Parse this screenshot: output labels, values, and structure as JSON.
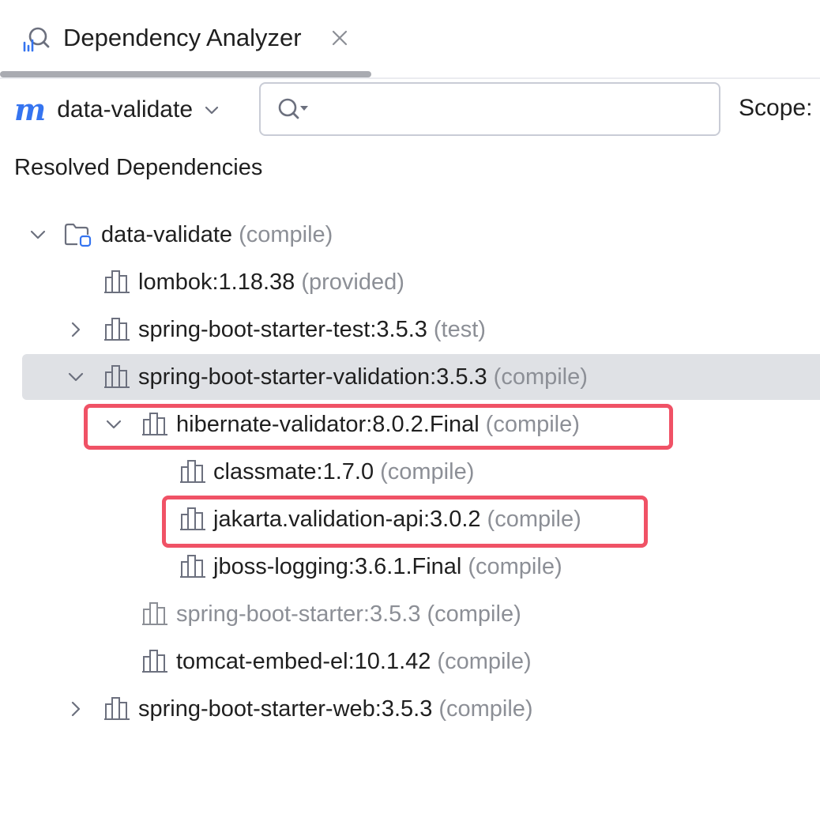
{
  "tab": {
    "title": "Dependency Analyzer"
  },
  "toolbar": {
    "module": "data-validate",
    "search_value": "",
    "scope_label": "Scope:"
  },
  "section_title": "Resolved Dependencies",
  "tree": {
    "root": {
      "name": "data-validate",
      "scope": "(compile)"
    },
    "lombok": {
      "name": "lombok:1.18.38",
      "scope": "(provided)"
    },
    "test": {
      "name": "spring-boot-starter-test:3.5.3",
      "scope": "(test)"
    },
    "validation": {
      "name": "spring-boot-starter-validation:3.5.3",
      "scope": "(compile)"
    },
    "hibernate": {
      "name": "hibernate-validator:8.0.2.Final",
      "scope": "(compile)"
    },
    "classmate": {
      "name": "classmate:1.7.0",
      "scope": "(compile)"
    },
    "jakarta": {
      "name": "jakarta.validation-api:3.0.2",
      "scope": "(compile)"
    },
    "jboss": {
      "name": "jboss-logging:3.6.1.Final",
      "scope": "(compile)"
    },
    "starter": {
      "name": "spring-boot-starter:3.5.3",
      "scope": "(compile)"
    },
    "tomcat": {
      "name": "tomcat-embed-el:10.1.42",
      "scope": "(compile)"
    },
    "web": {
      "name": "spring-boot-starter-web:3.5.3",
      "scope": "(compile)"
    }
  },
  "colors": {
    "accent": "#3574f0",
    "highlight": "#f05266",
    "selection": "#dfe1e5",
    "muted_text": "#8c8f96"
  }
}
